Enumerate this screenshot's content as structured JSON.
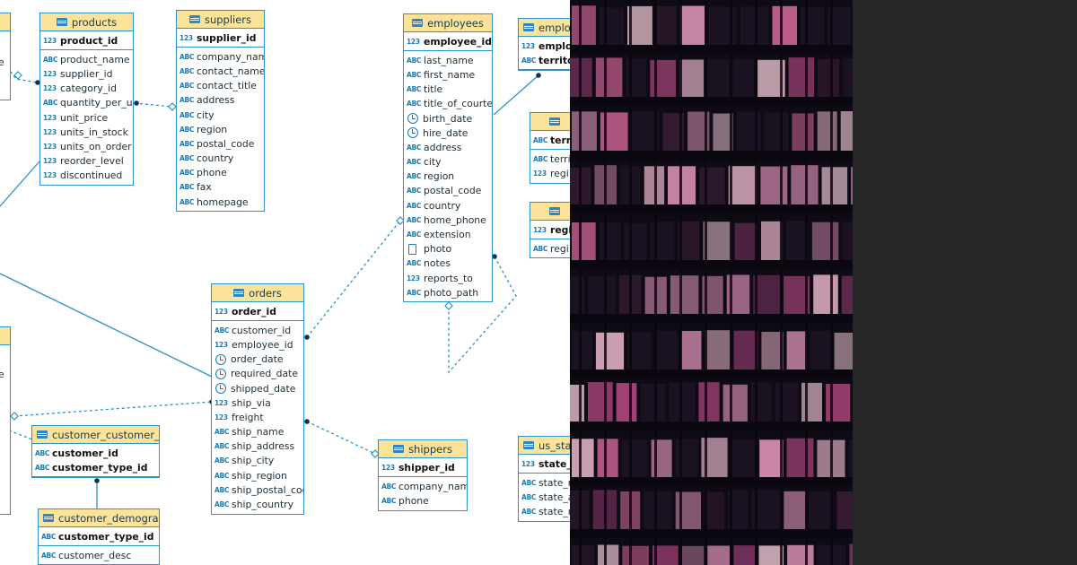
{
  "tables": {
    "t_left_top": {
      "title": "",
      "rows": [
        {
          "type": "",
          "name": "e"
        }
      ]
    },
    "t_left_bottom": {
      "title": "",
      "rows": [
        {
          "type": "",
          "name": "e"
        }
      ]
    },
    "products": {
      "title": "products",
      "pk": [
        {
          "type": "123",
          "name": "product_id"
        }
      ],
      "rows": [
        {
          "type": "ABC",
          "name": "product_name"
        },
        {
          "type": "123",
          "name": "supplier_id"
        },
        {
          "type": "123",
          "name": "category_id"
        },
        {
          "type": "ABC",
          "name": "quantity_per_unit"
        },
        {
          "type": "123",
          "name": "unit_price"
        },
        {
          "type": "123",
          "name": "units_in_stock"
        },
        {
          "type": "123",
          "name": "units_on_order"
        },
        {
          "type": "123",
          "name": "reorder_level"
        },
        {
          "type": "123",
          "name": "discontinued"
        }
      ]
    },
    "suppliers": {
      "title": "suppliers",
      "pk": [
        {
          "type": "123",
          "name": "supplier_id"
        }
      ],
      "rows": [
        {
          "type": "ABC",
          "name": "company_name"
        },
        {
          "type": "ABC",
          "name": "contact_name"
        },
        {
          "type": "ABC",
          "name": "contact_title"
        },
        {
          "type": "ABC",
          "name": "address"
        },
        {
          "type": "ABC",
          "name": "city"
        },
        {
          "type": "ABC",
          "name": "region"
        },
        {
          "type": "ABC",
          "name": "postal_code"
        },
        {
          "type": "ABC",
          "name": "country"
        },
        {
          "type": "ABC",
          "name": "phone"
        },
        {
          "type": "ABC",
          "name": "fax"
        },
        {
          "type": "ABC",
          "name": "homepage"
        }
      ]
    },
    "employees": {
      "title": "employees",
      "pk": [
        {
          "type": "123",
          "name": "employee_id"
        }
      ],
      "rows": [
        {
          "type": "ABC",
          "name": "last_name"
        },
        {
          "type": "ABC",
          "name": "first_name"
        },
        {
          "type": "ABC",
          "name": "title"
        },
        {
          "type": "ABC",
          "name": "title_of_courtesy"
        },
        {
          "type": "date",
          "name": "birth_date"
        },
        {
          "type": "date",
          "name": "hire_date"
        },
        {
          "type": "ABC",
          "name": "address"
        },
        {
          "type": "ABC",
          "name": "city"
        },
        {
          "type": "ABC",
          "name": "region"
        },
        {
          "type": "ABC",
          "name": "postal_code"
        },
        {
          "type": "ABC",
          "name": "country"
        },
        {
          "type": "ABC",
          "name": "home_phone"
        },
        {
          "type": "ABC",
          "name": "extension"
        },
        {
          "type": "blob",
          "name": "photo"
        },
        {
          "type": "ABC",
          "name": "notes"
        },
        {
          "type": "123",
          "name": "reports_to"
        },
        {
          "type": "ABC",
          "name": "photo_path"
        }
      ]
    },
    "employee_territories": {
      "title": "employ",
      "pk": [
        {
          "type": "123",
          "name": "employ"
        },
        {
          "type": "ABC",
          "name": "territo"
        }
      ],
      "rows": []
    },
    "territories": {
      "title": "",
      "pk": [
        {
          "type": "ABC",
          "name": "terri"
        }
      ],
      "rows": [
        {
          "type": "ABC",
          "name": "terri"
        },
        {
          "type": "123",
          "name": "regi"
        }
      ]
    },
    "region": {
      "title": "",
      "pk": [
        {
          "type": "123",
          "name": "regi"
        }
      ],
      "rows": [
        {
          "type": "ABC",
          "name": "regi"
        }
      ]
    },
    "orders": {
      "title": "orders",
      "pk": [
        {
          "type": "123",
          "name": "order_id"
        }
      ],
      "rows": [
        {
          "type": "ABC",
          "name": "customer_id"
        },
        {
          "type": "123",
          "name": "employee_id"
        },
        {
          "type": "date",
          "name": "order_date"
        },
        {
          "type": "date",
          "name": "required_date"
        },
        {
          "type": "date",
          "name": "shipped_date"
        },
        {
          "type": "123",
          "name": "ship_via"
        },
        {
          "type": "123",
          "name": "freight"
        },
        {
          "type": "ABC",
          "name": "ship_name"
        },
        {
          "type": "ABC",
          "name": "ship_address"
        },
        {
          "type": "ABC",
          "name": "ship_city"
        },
        {
          "type": "ABC",
          "name": "ship_region"
        },
        {
          "type": "ABC",
          "name": "ship_postal_code"
        },
        {
          "type": "ABC",
          "name": "ship_country"
        }
      ]
    },
    "shippers": {
      "title": "shippers",
      "pk": [
        {
          "type": "123",
          "name": "shipper_id"
        }
      ],
      "rows": [
        {
          "type": "ABC",
          "name": "company_name"
        },
        {
          "type": "ABC",
          "name": "phone"
        }
      ]
    },
    "customer_customer_demo": {
      "title": "customer_customer_demo",
      "pk": [
        {
          "type": "ABC",
          "name": "customer_id"
        },
        {
          "type": "ABC",
          "name": "customer_type_id"
        }
      ],
      "rows": []
    },
    "customer_demographics": {
      "title": "customer_demographics",
      "pk": [
        {
          "type": "ABC",
          "name": "customer_type_id"
        }
      ],
      "rows": [
        {
          "type": "ABC",
          "name": "customer_desc"
        }
      ]
    },
    "us_states": {
      "title": "us_sta",
      "pk": [
        {
          "type": "123",
          "name": "state_i"
        }
      ],
      "rows": [
        {
          "type": "ABC",
          "name": "state_n"
        },
        {
          "type": "ABC",
          "name": "state_a"
        },
        {
          "type": "ABC",
          "name": "state_r"
        }
      ]
    }
  },
  "colors": {
    "table_border": "#2b94c4",
    "header_fill": "#fbe39a",
    "link": "#2b94c4",
    "right_panel": "#262626",
    "disc": "#707070"
  }
}
